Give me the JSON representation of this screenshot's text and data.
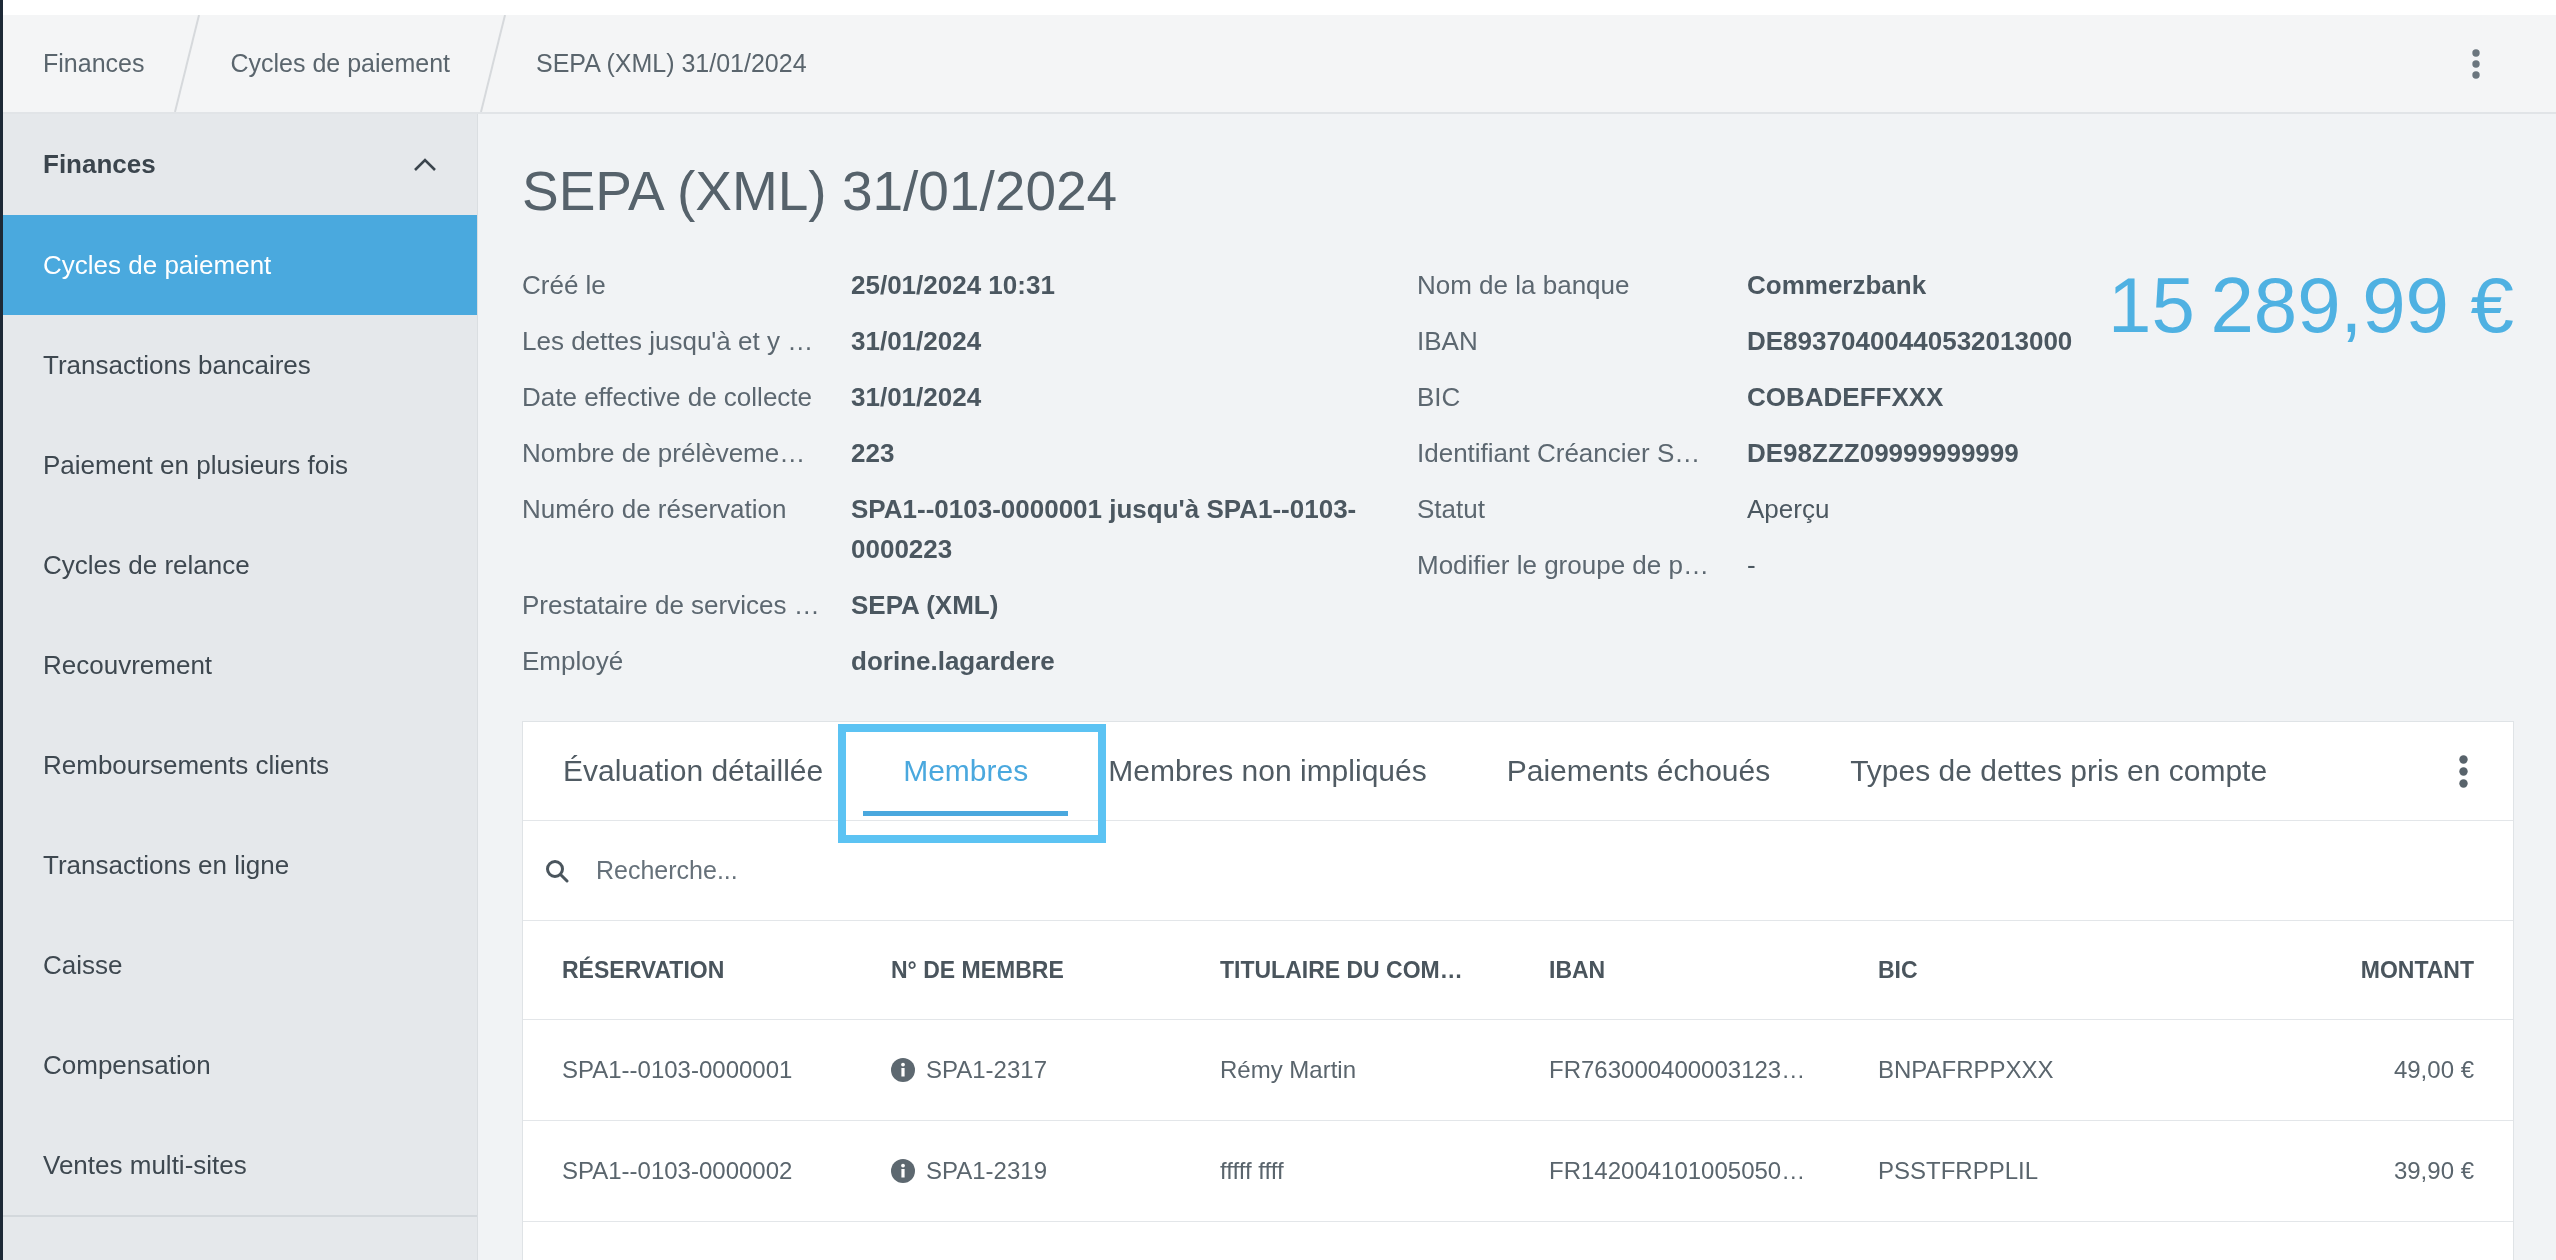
{
  "breadcrumb": [
    {
      "label": "Finances"
    },
    {
      "label": "Cycles de paiement"
    },
    {
      "label": "SEPA (XML) 31/01/2024"
    }
  ],
  "sidebar": {
    "section": "Finances",
    "expanded": true,
    "items": [
      {
        "label": "Cycles de paiement",
        "selected": true
      },
      {
        "label": "Transactions bancaires",
        "selected": false
      },
      {
        "label": "Paiement en plusieurs fois",
        "selected": false
      },
      {
        "label": "Cycles de relance",
        "selected": false
      },
      {
        "label": "Recouvrement",
        "selected": false
      },
      {
        "label": "Remboursements clients",
        "selected": false
      },
      {
        "label": "Transactions en ligne",
        "selected": false
      },
      {
        "label": "Caisse",
        "selected": false
      },
      {
        "label": "Compensation",
        "selected": false
      },
      {
        "label": "Ventes multi-sites",
        "selected": false
      }
    ]
  },
  "page": {
    "title": "SEPA (XML) 31/01/2024",
    "amount": "15 289,99 €"
  },
  "details_left": [
    {
      "label": "Créé le",
      "value": "25/01/2024 10:31",
      "emphasized": true
    },
    {
      "label": "Les dettes jusqu'à et y …",
      "value": "31/01/2024",
      "emphasized": true
    },
    {
      "label": "Date effective de collecte",
      "value": "31/01/2024",
      "emphasized": true
    },
    {
      "label": "Nombre de prélèveme…",
      "value": "223",
      "emphasized": true
    },
    {
      "label": "Numéro de réservation",
      "value": "SPA1--0103-0000001 jusqu'à SPA1--0103-0000223",
      "emphasized": true
    },
    {
      "label": "Prestataire de services …",
      "value": "SEPA (XML)",
      "emphasized": true
    },
    {
      "label": "Employé",
      "value": "dorine.lagardere",
      "emphasized": true
    }
  ],
  "details_right": [
    {
      "label": "Nom de la banque",
      "value": "Commerzbank",
      "emphasized": true
    },
    {
      "label": "IBAN",
      "value": "DE89370400440532013000",
      "emphasized": true
    },
    {
      "label": "BIC",
      "value": "COBADEFFXXX",
      "emphasized": true
    },
    {
      "label": "Identifiant Créancier S…",
      "value": "DE98ZZZ09999999999",
      "emphasized": true
    },
    {
      "label": "Statut",
      "value": "Aperçu",
      "emphasized": false
    },
    {
      "label": "Modifier le groupe de p…",
      "value": "-",
      "emphasized": false
    }
  ],
  "tabs": [
    {
      "label": "Évaluation détaillée",
      "selected": false,
      "highlighted": false
    },
    {
      "label": "Membres",
      "selected": true,
      "highlighted": true
    },
    {
      "label": "Membres non impliqués",
      "selected": false,
      "highlighted": false
    },
    {
      "label": "Paiements échoués",
      "selected": false,
      "highlighted": false
    },
    {
      "label": "Types de dettes pris en compte",
      "selected": false,
      "highlighted": false
    }
  ],
  "search": {
    "placeholder": "Recherche..."
  },
  "table": {
    "columns": [
      {
        "label": "RÉSERVATION",
        "kind": "text"
      },
      {
        "label": "N° DE MEMBRE",
        "kind": "member"
      },
      {
        "label": "TITULAIRE DU COM…",
        "kind": "text"
      },
      {
        "label": "IBAN",
        "kind": "text"
      },
      {
        "label": "BIC",
        "kind": "text"
      },
      {
        "label": "MONTANT",
        "kind": "amount"
      }
    ],
    "rows": [
      {
        "cells": [
          "SPA1--0103-0000001",
          "SPA1-2317",
          "Rémy Martin",
          "FR763000400003123…",
          "BNPAFRPPXXX",
          "49,00 €"
        ]
      },
      {
        "cells": [
          "SPA1--0103-0000002",
          "SPA1-2319",
          "fffff ffff",
          "FR142004101005050…",
          "PSSTFRPPLIL",
          "39,90 €"
        ]
      }
    ]
  }
}
